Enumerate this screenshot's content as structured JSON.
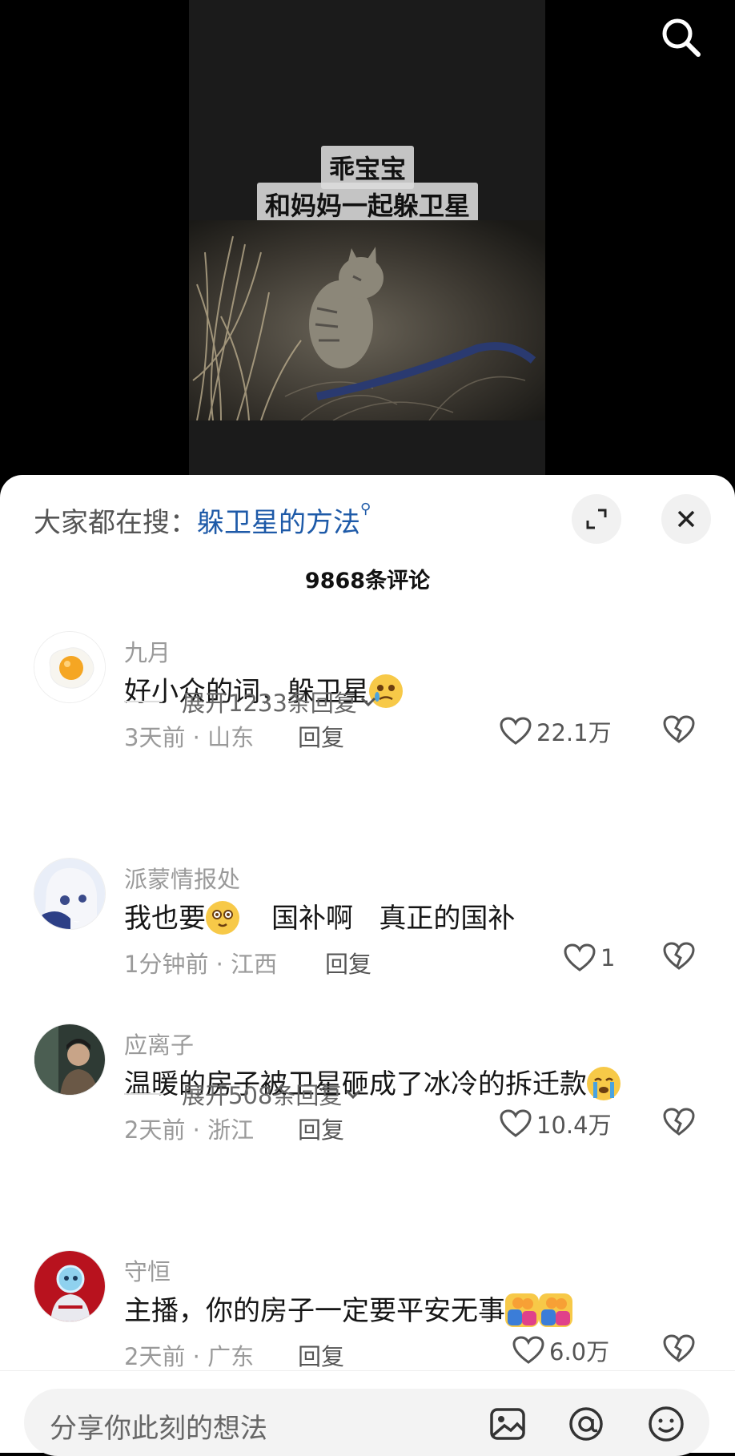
{
  "video": {
    "caption_line1": "乖宝宝",
    "caption_line2": "和妈妈一起躲卫星"
  },
  "comments_panel": {
    "hot_search_prefix": "大家都在搜：",
    "hot_search_term": "躲卫星的方法",
    "comment_count": "9868条评论",
    "comments": [
      {
        "username": "九月",
        "text": "好小众的词，躲卫星",
        "meta": "3天前 · 山东",
        "reply_label": "回复",
        "likes": "22.1万",
        "expand": "展开1233条回复"
      },
      {
        "username": "派蒙情报处",
        "text_a": "我也要",
        "text_b": "国补啊   真正的国补",
        "meta": "1分钟前 · 江西",
        "reply_label": "回复",
        "likes": "1"
      },
      {
        "username": "应离子",
        "text": "温暖的房子被卫星砸成了冰冷的拆迁款",
        "meta": "2天前 · 浙江",
        "reply_label": "回复",
        "likes": "10.4万",
        "expand": "展开508条回复"
      },
      {
        "username": "守恒",
        "text": "主播，你的房子一定要平安无事",
        "meta": "2天前 · 广东",
        "reply_label": "回复",
        "likes": "6.0万"
      }
    ]
  },
  "input": {
    "placeholder": "分享你此刻的想法"
  },
  "colors": {
    "accent_link": "#1e5aa8",
    "muted_text": "#9a9a9a",
    "sheet_bg": "#ffffff"
  },
  "icons": [
    "search-icon",
    "fullscreen-icon",
    "close-icon",
    "heart-icon",
    "heart-broken-icon",
    "chevron-down-icon",
    "image-icon",
    "at-icon",
    "emoji-icon"
  ]
}
